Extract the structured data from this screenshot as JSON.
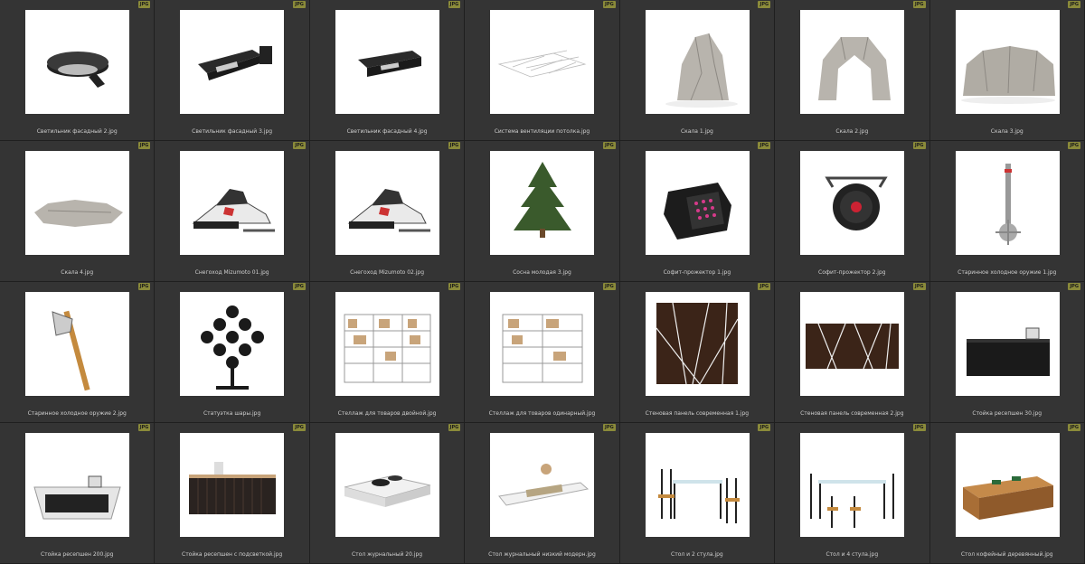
{
  "badge_label": "JPG",
  "files": [
    {
      "name": "Светильник фасадный 2.jpg",
      "icon": "wall-lamp-round"
    },
    {
      "name": "Светильник фасадный 3.jpg",
      "icon": "wall-lamp-flood"
    },
    {
      "name": "Светильник фасадный 4.jpg",
      "icon": "wall-lamp-box"
    },
    {
      "name": "Система вентиляции потолка.jpg",
      "icon": "ceiling-grid"
    },
    {
      "name": "Скала 1.jpg",
      "icon": "rock"
    },
    {
      "name": "Скала 2.jpg",
      "icon": "rock-arch"
    },
    {
      "name": "Скала 3.jpg",
      "icon": "rock-wide"
    },
    {
      "name": "Скала 4.jpg",
      "icon": "rock-flat"
    },
    {
      "name": "Снегоход Mizumoto 01.jpg",
      "icon": "snowmobile"
    },
    {
      "name": "Снегоход Mizumoto 02.jpg",
      "icon": "snowmobile"
    },
    {
      "name": "Сосна молодая 3.jpg",
      "icon": "pine-tree"
    },
    {
      "name": "Софит-прожектор 1.jpg",
      "icon": "led-projector"
    },
    {
      "name": "Софит-прожектор 2.jpg",
      "icon": "par-light"
    },
    {
      "name": "Старинное холодное оружие 1.jpg",
      "icon": "mace"
    },
    {
      "name": "Старинное холодное оружие 2.jpg",
      "icon": "axe"
    },
    {
      "name": "Статуэтка шары.jpg",
      "icon": "ball-sculpture"
    },
    {
      "name": "Стеллаж для товаров двойной.jpg",
      "icon": "shelf-double"
    },
    {
      "name": "Стеллаж для товаров одинарный.jpg",
      "icon": "shelf-single"
    },
    {
      "name": "Стеновая панель современная 1.jpg",
      "icon": "wall-panel-square"
    },
    {
      "name": "Стеновая панель современная 2.jpg",
      "icon": "wall-panel-wide"
    },
    {
      "name": "Стойка ресепшен 30.jpg",
      "icon": "reception-desk-black"
    },
    {
      "name": "Стойка ресепшен 200.jpg",
      "icon": "reception-desk-white"
    },
    {
      "name": "Стойка ресепшен с подсветкой.jpg",
      "icon": "reception-desk-lit"
    },
    {
      "name": "Стол журнальный 20.jpg",
      "icon": "coffee-table-white"
    },
    {
      "name": "Стол журнальный низкий модерн.jpg",
      "icon": "coffee-table-low"
    },
    {
      "name": "Стол и 2 стула.jpg",
      "icon": "table-2-chairs"
    },
    {
      "name": "Стол и 4 стула.jpg",
      "icon": "table-4-chairs"
    },
    {
      "name": "Стол кофейный деревянный.jpg",
      "icon": "wooden-coffee-table"
    }
  ]
}
